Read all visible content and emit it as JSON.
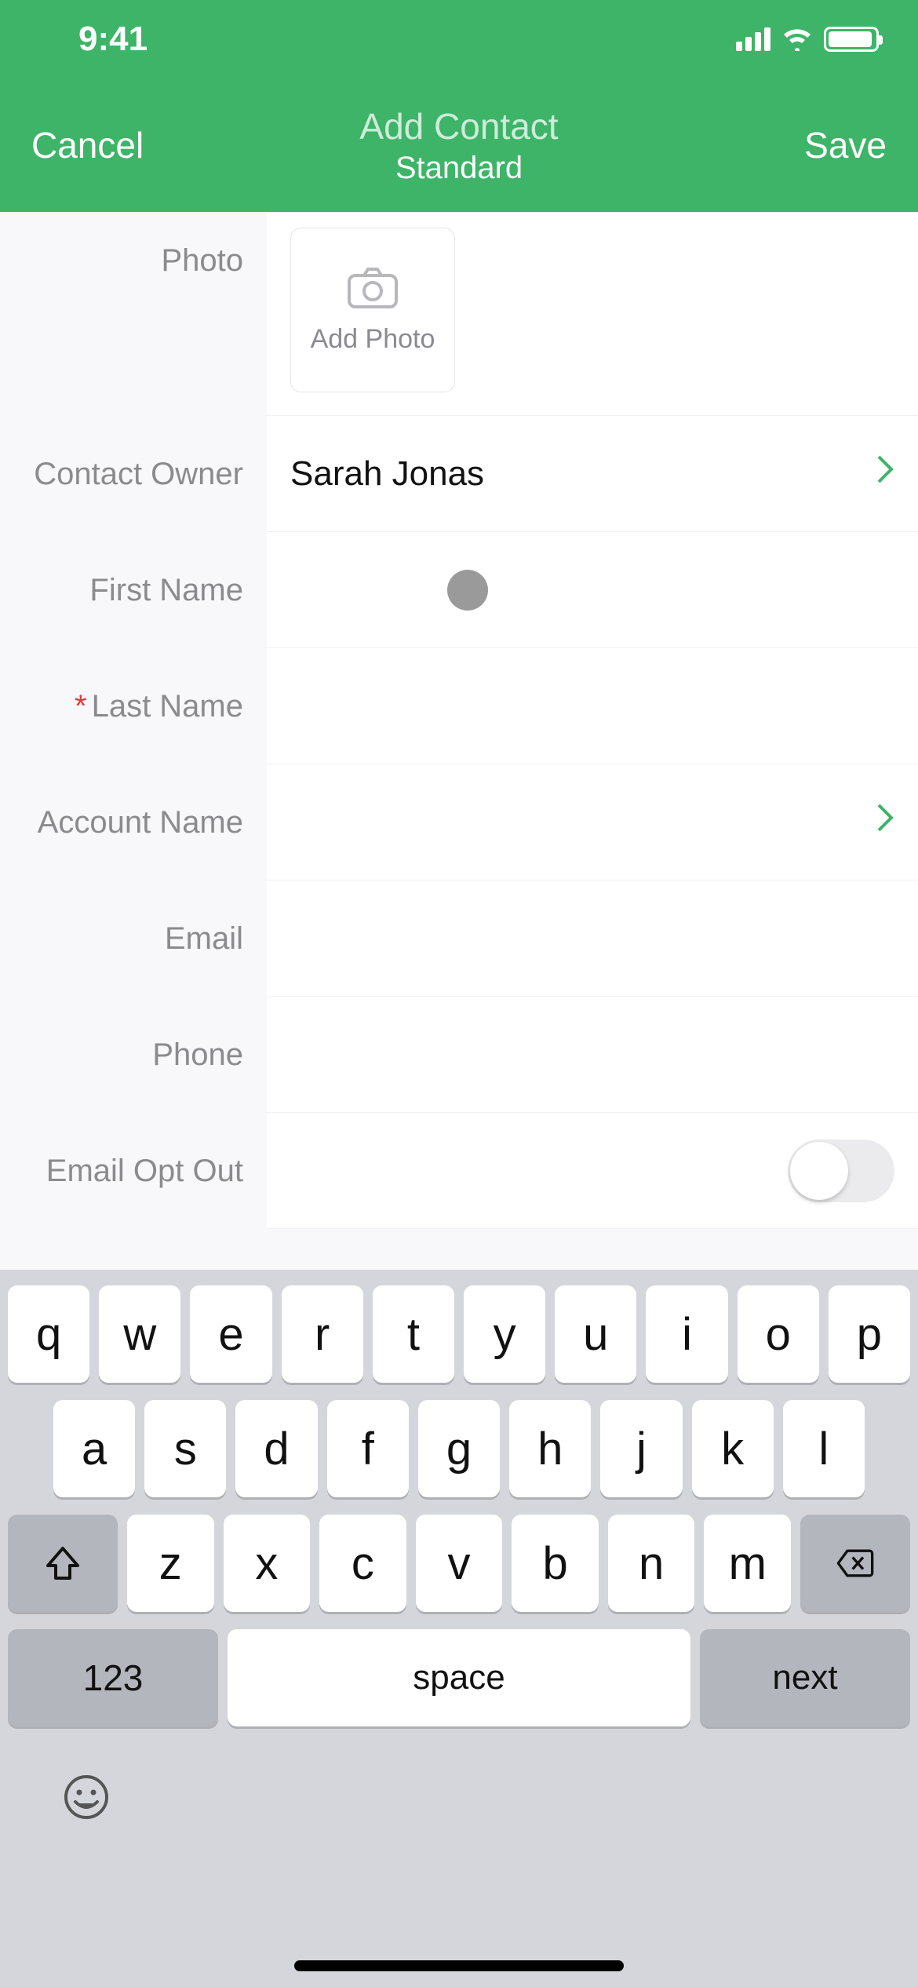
{
  "statusbar": {
    "time": "9:41"
  },
  "navbar": {
    "cancel": "Cancel",
    "title": "Add Contact",
    "subtitle": "Standard",
    "save": "Save"
  },
  "form": {
    "photo_label": "Photo",
    "add_photo": "Add Photo",
    "contact_owner_label": "Contact Owner",
    "contact_owner_value": "Sarah Jonas",
    "first_name_label": "First Name",
    "first_name_value": "",
    "last_name_label": "Last Name",
    "last_name_value": "",
    "last_name_required": true,
    "account_name_label": "Account Name",
    "account_name_value": "",
    "email_label": "Email",
    "email_value": "",
    "phone_label": "Phone",
    "phone_value": "",
    "email_optout_label": "Email Opt Out",
    "email_optout_value": false
  },
  "keyboard": {
    "row1": [
      "q",
      "w",
      "e",
      "r",
      "t",
      "y",
      "u",
      "i",
      "o",
      "p"
    ],
    "row2": [
      "a",
      "s",
      "d",
      "f",
      "g",
      "h",
      "j",
      "k",
      "l"
    ],
    "row3": [
      "z",
      "x",
      "c",
      "v",
      "b",
      "n",
      "m"
    ],
    "numkey": "123",
    "space": "space",
    "action": "next"
  }
}
